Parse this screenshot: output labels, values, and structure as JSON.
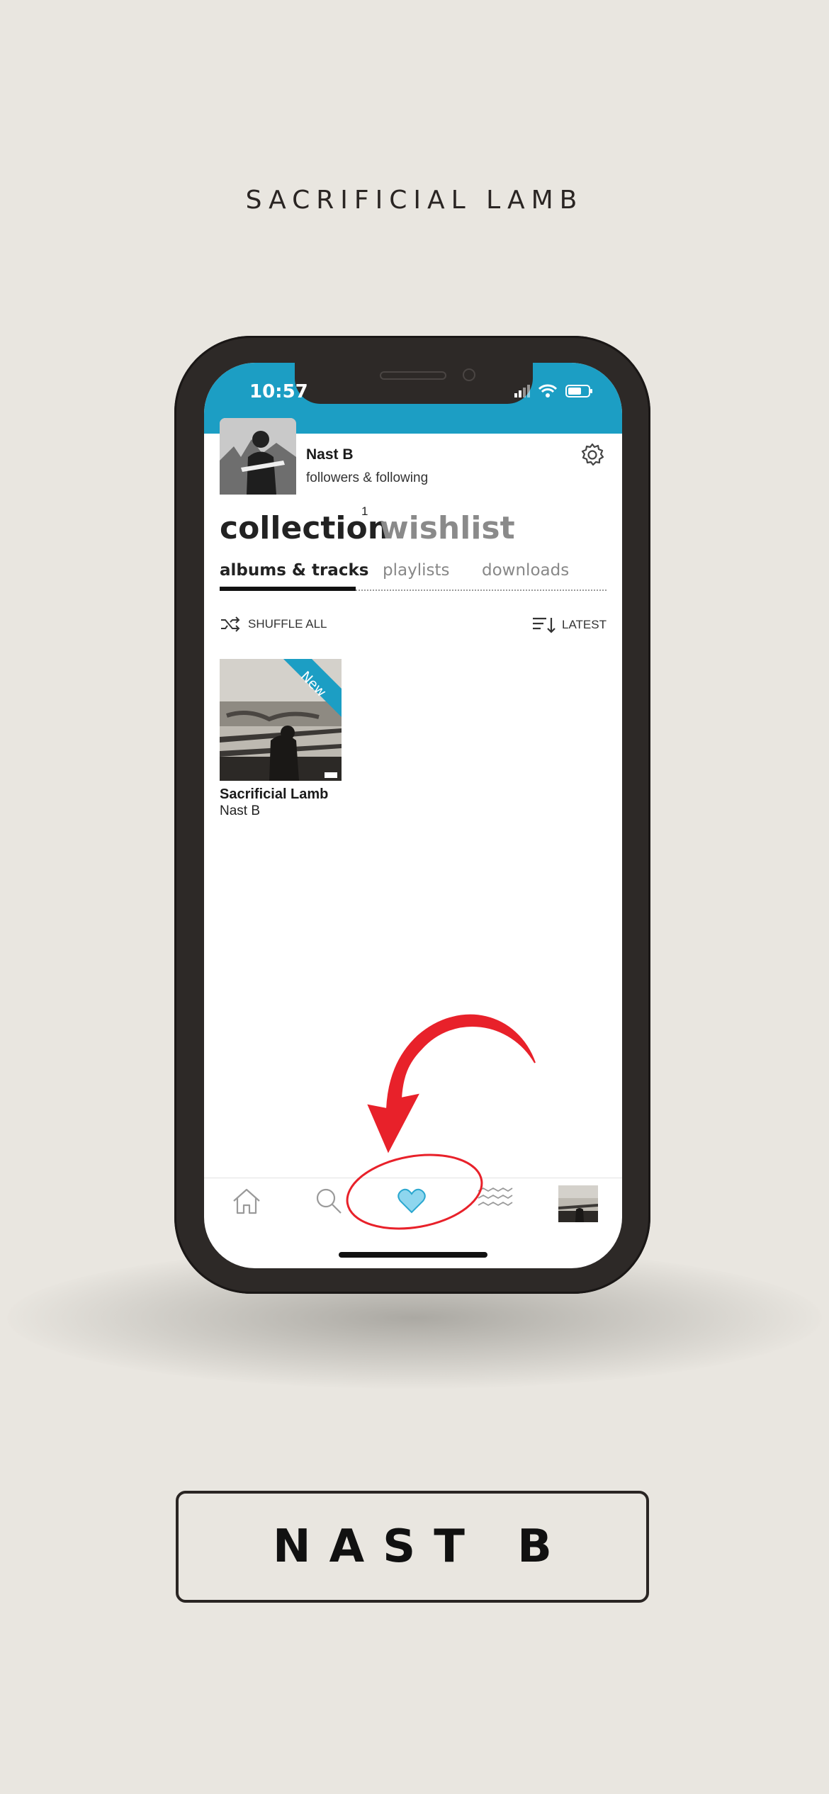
{
  "header": {
    "title": "SACRIFICIAL LAMB"
  },
  "status_bar": {
    "time": "10:57"
  },
  "profile": {
    "name": "Nast B",
    "subtitle": "followers & following"
  },
  "main_tabs": {
    "collection": "collection",
    "collection_count": "1",
    "wishlist": "wishlist"
  },
  "sub_tabs": [
    {
      "label": "albums & tracks",
      "active": true
    },
    {
      "label": "playlists",
      "active": false
    },
    {
      "label": "downloads",
      "active": false
    }
  ],
  "actions": {
    "shuffle_label": "SHUFFLE ALL",
    "sort_label": "LATEST"
  },
  "albums": [
    {
      "title": "Sacrificial Lamb",
      "artist": "Nast B",
      "badge": "New"
    }
  ],
  "bottom_nav": [
    "home-icon",
    "search-icon",
    "heart-icon",
    "feed-icon",
    "now-playing-thumbnail"
  ],
  "footer": {
    "artist_label": "NAST B"
  },
  "colors": {
    "accent": "#1c9ec4",
    "background": "#e9e6e0",
    "annotation": "#e8212a",
    "heart": "#5fc4e2"
  }
}
